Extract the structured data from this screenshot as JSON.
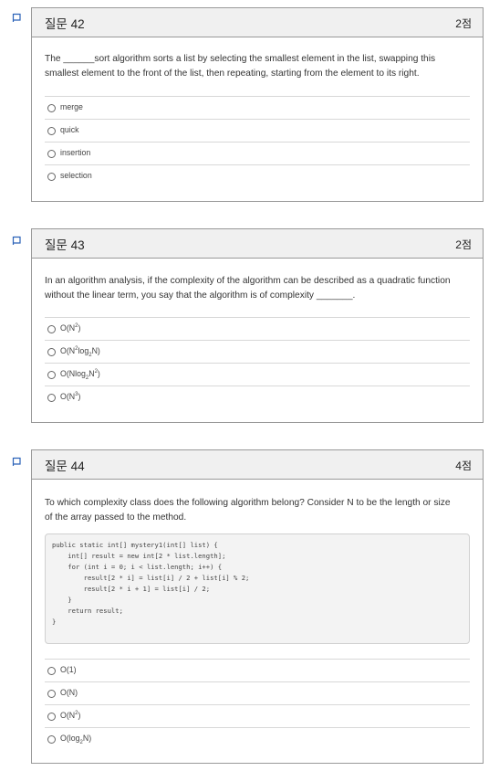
{
  "questions": [
    {
      "title": "질문 42",
      "points": "2점",
      "text_line1": "The ______sort algorithm sorts a list by selecting the smallest element in the list, swapping this",
      "text_line2": "smallest element to the front of the list, then repeating, starting from the element to its right.",
      "options": [
        {
          "label": "merge"
        },
        {
          "label": "quick"
        },
        {
          "label": "insertion"
        },
        {
          "label": "selection"
        }
      ]
    },
    {
      "title": "질문 43",
      "points": "2점",
      "text_line1": "In an algorithm analysis, if the complexity of the algorithm can be described as a quadratic function",
      "text_line2": "without the linear term, you say that the algorithm is of complexity _______.",
      "options": [
        {
          "pre": "O(N",
          "sup": "2",
          "post": ")"
        },
        {
          "pre": "O(N",
          "sup": "2",
          "mid": "log",
          "sub": "2",
          "post": "N)"
        },
        {
          "pre": "O(Nlog",
          "sub": "2",
          "mid": "N",
          "sup": "2",
          "post": ")"
        },
        {
          "pre": "O(N",
          "sup": "3",
          "post": ")"
        }
      ]
    },
    {
      "title": "질문 44",
      "points": "4점",
      "text_line1": "To which complexity class does the following algorithm belong? Consider N to be the length or size",
      "text_line2": "of the array passed to the method.",
      "code": [
        "public static int[] mystery1(int[] list) {",
        "    int[] result = new int[2 * list.length];",
        "    for (int i = 0; i < list.length; i++) {",
        "        result[2 * i] = list[i] / 2 + list[i] % 2;",
        "        result[2 * i + 1] = list[i] / 2;",
        "    }",
        "    return result;",
        "}"
      ],
      "options": [
        {
          "pre": "O(1)"
        },
        {
          "pre": "O(N)"
        },
        {
          "pre": "O(N",
          "sup": "2",
          "post": ")"
        },
        {
          "pre": "O(log",
          "sub": "2",
          "post": "N)"
        }
      ]
    }
  ],
  "colors": {
    "border": "#999999",
    "header_bg": "#f0f0f0",
    "flag_blue": "#2a62b8"
  }
}
